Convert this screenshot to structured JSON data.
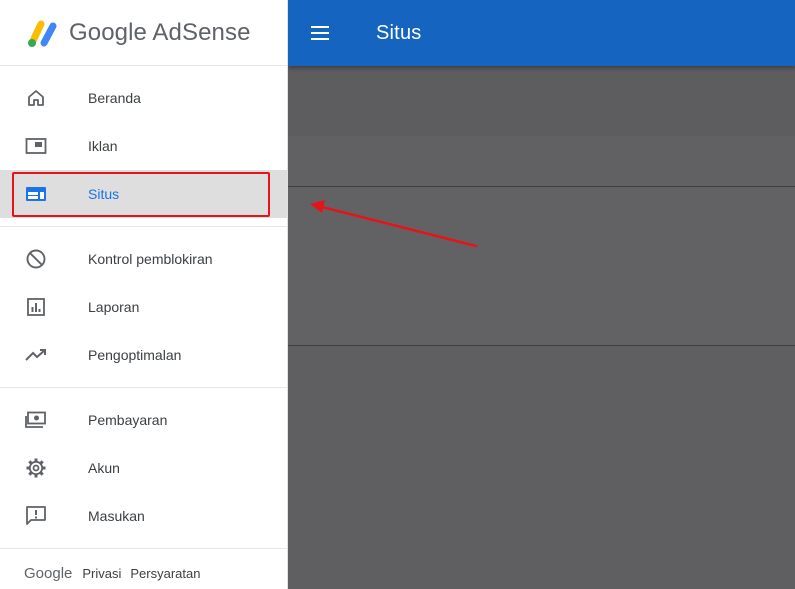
{
  "brand": {
    "name": "Google AdSense"
  },
  "appbar": {
    "title": "Situs"
  },
  "sidebar": {
    "groups": [
      [
        {
          "label": "Beranda",
          "icon": "home-icon"
        },
        {
          "label": "Iklan",
          "icon": "ad-unit-icon"
        },
        {
          "label": "Situs",
          "icon": "web-icon",
          "active": true
        }
      ],
      [
        {
          "label": "Kontrol pemblokiran",
          "icon": "block-icon"
        },
        {
          "label": "Laporan",
          "icon": "report-chart-icon"
        },
        {
          "label": "Pengoptimalan",
          "icon": "trending-up-icon"
        }
      ],
      [
        {
          "label": "Pembayaran",
          "icon": "payments-icon"
        },
        {
          "label": "Akun",
          "icon": "gear-icon"
        },
        {
          "label": "Masukan",
          "icon": "feedback-icon"
        }
      ]
    ]
  },
  "footer": {
    "brand": "Google",
    "privacy": "Privasi",
    "terms": "Persyaratan"
  },
  "colors": {
    "appbar": "#1565c0",
    "active_label": "#1a73e8",
    "highlight_box": "#e5141c",
    "arrow": "#e5141c",
    "overlay": "#616161"
  }
}
